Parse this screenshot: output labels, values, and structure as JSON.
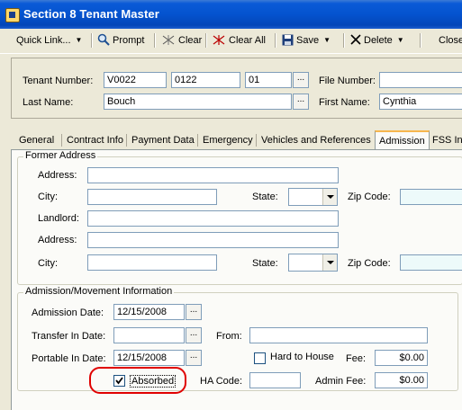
{
  "window": {
    "title": "Section 8 Tenant Master"
  },
  "toolbar": {
    "quick_link": "Quick Link...",
    "prompt": "Prompt",
    "clear": "Clear",
    "clear_all": "Clear All",
    "save": "Save",
    "delete": "Delete",
    "close": "Close"
  },
  "header": {
    "tenant_number_label": "Tenant Number:",
    "tenant_number_1": "V0022",
    "tenant_number_2": "0122",
    "tenant_number_3": "01",
    "file_number_label": "File Number:",
    "file_number": "",
    "last_name_label": "Last Name:",
    "last_name": "Bouch",
    "first_name_label": "First Name:",
    "first_name": "Cynthia",
    "lookup_label": "..."
  },
  "tabs": [
    "General",
    "Contract Info",
    "Payment Data",
    "Emergency",
    "Vehicles and References",
    "Admission",
    "FSS In"
  ],
  "active_tab": "Admission",
  "former_address": {
    "title": "Former Address",
    "address_label": "Address:",
    "city_label": "City:",
    "state_label": "State:",
    "zip_label": "Zip Code:",
    "landlord_label": "Landlord:",
    "address_label_2": "Address:",
    "city_label_2": "City:",
    "state_label_2": "State:",
    "zip_label_2": "Zip Code:"
  },
  "admission": {
    "title": "Admission/Movement Information",
    "admission_date_label": "Admission Date:",
    "admission_date": "12/15/2008",
    "transfer_in_label": "Transfer In Date:",
    "transfer_in_date": "",
    "from_label": "From:",
    "portable_in_label": "Portable In Date:",
    "portable_in_date": "12/15/2008",
    "hard_to_house_label": "Hard to House",
    "hard_to_house_checked": false,
    "fee_label": "Fee:",
    "fee": "$0.00",
    "absorbed_label": "Absorbed",
    "absorbed_checked": true,
    "ha_code_label": "HA Code:",
    "ha_code": "",
    "admin_fee_label": "Admin Fee:",
    "admin_fee": "$0.00"
  },
  "colors": {
    "title_bar": "#0453cf",
    "highlight": "#e00000",
    "zip_field": "#edfafa"
  }
}
